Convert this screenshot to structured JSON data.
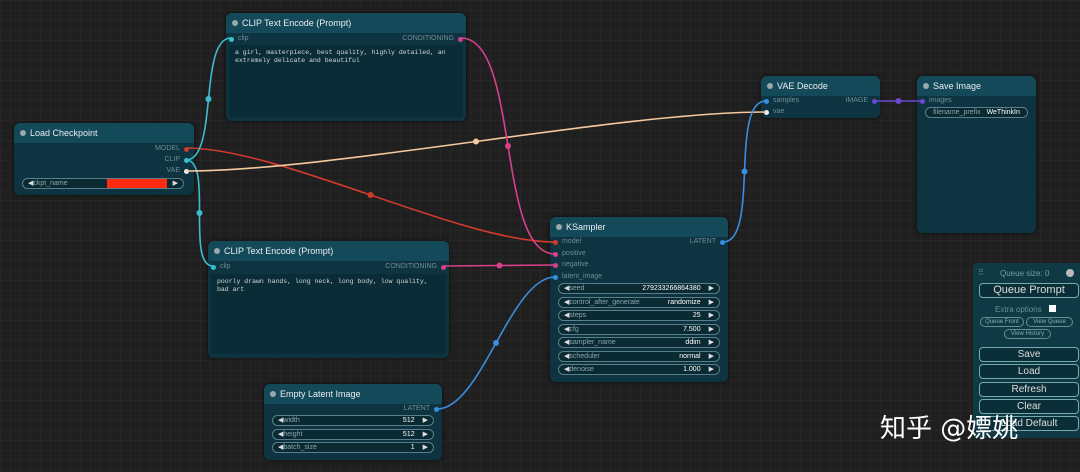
{
  "nodes": {
    "load_checkpoint": {
      "title": "Load Checkpoint",
      "outputs": [
        "MODEL",
        "CLIP",
        "VAE"
      ],
      "widget": {
        "label": "ckpt_name",
        "value": ""
      }
    },
    "clip_pos": {
      "title": "CLIP Text Encode (Prompt)",
      "input": "clip",
      "output": "CONDITIONING",
      "text": "a girl, masterpiece, best quality, highly detailed, an extremely delicate and beautiful"
    },
    "clip_neg": {
      "title": "CLIP Text Encode (Prompt)",
      "input": "clip",
      "output": "CONDITIONING",
      "text": "poorly drawn hands, long neck, long body, low quality, bad art"
    },
    "ksampler": {
      "title": "KSampler",
      "inputs": [
        "model",
        "positive",
        "negative",
        "latent_image"
      ],
      "output": "LATENT",
      "widgets": [
        {
          "label": "seed",
          "value": "279233266864380"
        },
        {
          "label": "control_after_generate",
          "value": "randomize"
        },
        {
          "label": "steps",
          "value": "25"
        },
        {
          "label": "cfg",
          "value": "7.500"
        },
        {
          "label": "sampler_name",
          "value": "ddim"
        },
        {
          "label": "scheduler",
          "value": "normal"
        },
        {
          "label": "denoise",
          "value": "1.000"
        }
      ]
    },
    "empty_latent": {
      "title": "Empty Latent Image",
      "output": "LATENT",
      "widgets": [
        {
          "label": "width",
          "value": "512"
        },
        {
          "label": "height",
          "value": "512"
        },
        {
          "label": "batch_size",
          "value": "1"
        }
      ]
    },
    "vae_decode": {
      "title": "VAE Decode",
      "inputs": [
        "samples",
        "vae"
      ],
      "output": "IMAGE"
    },
    "save_image": {
      "title": "Save Image",
      "input": "images",
      "widget": {
        "label": "filename_prefix",
        "value": "WeThinkIn"
      }
    }
  },
  "menu": {
    "queue_size": "Queue size: 0",
    "queue_prompt": "Queue Prompt",
    "extra_options": "Extra options",
    "queue_front": "Queue Front",
    "view_queue": "View Queue",
    "view_history": "View History",
    "save": "Save",
    "load": "Load",
    "refresh": "Refresh",
    "clear": "Clear",
    "load_default": "Load Default"
  },
  "watermark": "知乎 @嫖姚",
  "colors": {
    "model": "#d23a2a",
    "clip": "#3bbcd0",
    "vae": "#f5c9a0",
    "conditioning": "#d8408c",
    "latent": "#3a8ee0",
    "image": "#6a48d0",
    "ckpt_value": "#ff2a10"
  }
}
